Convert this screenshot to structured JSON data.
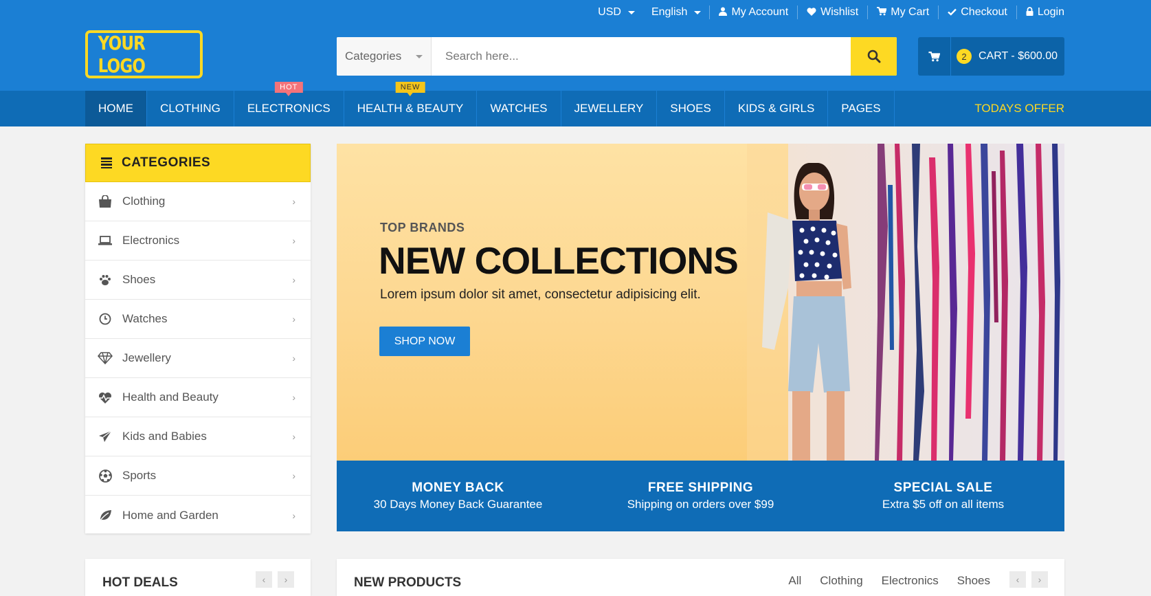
{
  "topbar": {
    "currency": "USD",
    "language": "English",
    "links": [
      {
        "label": "My Account",
        "icon": "user-icon"
      },
      {
        "label": "Wishlist",
        "icon": "heart-icon"
      },
      {
        "label": "My Cart",
        "icon": "cart-icon"
      },
      {
        "label": "Checkout",
        "icon": "check-icon"
      },
      {
        "label": "Login",
        "icon": "lock-icon"
      }
    ]
  },
  "logo": {
    "text": "YOUR LOGO"
  },
  "search": {
    "category": "Categories",
    "placeholder": "Search here..."
  },
  "cart": {
    "count": "2",
    "label": "CART - $600.00"
  },
  "nav": {
    "items": [
      {
        "label": "HOME",
        "active": true
      },
      {
        "label": "CLOTHING"
      },
      {
        "label": "ELECTRONICS",
        "tag": "HOT"
      },
      {
        "label": "HEALTH & BEAUTY",
        "tag": "NEW"
      },
      {
        "label": "WATCHES"
      },
      {
        "label": "JEWELLERY"
      },
      {
        "label": "SHOES"
      },
      {
        "label": "KIDS & GIRLS"
      },
      {
        "label": "PAGES"
      }
    ],
    "offer": "TODAYS OFFER"
  },
  "sidebar": {
    "title": "CATEGORIES",
    "items": [
      {
        "label": "Clothing",
        "icon": "shopping-bag-icon"
      },
      {
        "label": "Electronics",
        "icon": "laptop-icon"
      },
      {
        "label": "Shoes",
        "icon": "paw-icon"
      },
      {
        "label": "Watches",
        "icon": "clock-icon"
      },
      {
        "label": "Jewellery",
        "icon": "diamond-icon"
      },
      {
        "label": "Health and Beauty",
        "icon": "heartbeat-icon"
      },
      {
        "label": "Kids and Babies",
        "icon": "paper-plane-icon"
      },
      {
        "label": "Sports",
        "icon": "soccer-ball-icon"
      },
      {
        "label": "Home and Garden",
        "icon": "leaf-icon"
      }
    ]
  },
  "banner": {
    "subtitle": "TOP BRANDS",
    "title": "NEW COLLECTIONS",
    "description": "Lorem ipsum dolor sit amet, consectetur adipisicing elit.",
    "button": "SHOP NOW"
  },
  "features": [
    {
      "title": "MONEY BACK",
      "desc": "30 Days Money Back Guarantee"
    },
    {
      "title": "FREE SHIPPING",
      "desc": "Shipping on orders over $99"
    },
    {
      "title": "SPECIAL SALE",
      "desc": "Extra $5 off on all items"
    }
  ],
  "hotdeals": {
    "title": "HOT DEALS"
  },
  "newproducts": {
    "title": "NEW PRODUCTS",
    "filters": [
      "All",
      "Clothing",
      "Electronics",
      "Shoes"
    ]
  },
  "colors": {
    "primary": "#1b7fd4",
    "dark": "#0f6cb6",
    "accent": "#fdd923",
    "hot": "#f4737a"
  }
}
